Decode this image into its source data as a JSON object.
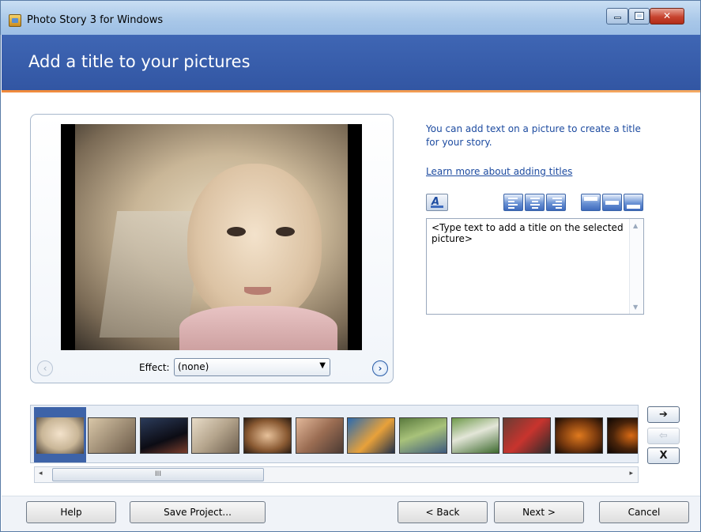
{
  "window": {
    "title": "Photo Story 3 for Windows"
  },
  "banner": {
    "title": "Add a title to your pictures"
  },
  "info": {
    "text": "You can add text on a picture to create a title for your story.",
    "link": "Learn more about adding titles"
  },
  "effect": {
    "label": "Effect:",
    "value": "(none)"
  },
  "title_box": {
    "placeholder": "<Type text to add a title on the selected picture>"
  },
  "filmstrip": {
    "thumbnail_count": 12,
    "selected_index": 0
  },
  "side_buttons": {
    "move_right": "➔",
    "move_left": "⇦",
    "remove": "X"
  },
  "scroll": {
    "left": "◂",
    "right": "▸",
    "grip": "III"
  },
  "buttons": {
    "help": "Help",
    "save": "Save Project...",
    "back": "< Back",
    "next": "Next >",
    "cancel": "Cancel"
  },
  "colors": {
    "banner": "#3f66b4",
    "accent_rule": "#f08a3c",
    "link": "#1d4ba0",
    "selection": "#3d63a8"
  }
}
